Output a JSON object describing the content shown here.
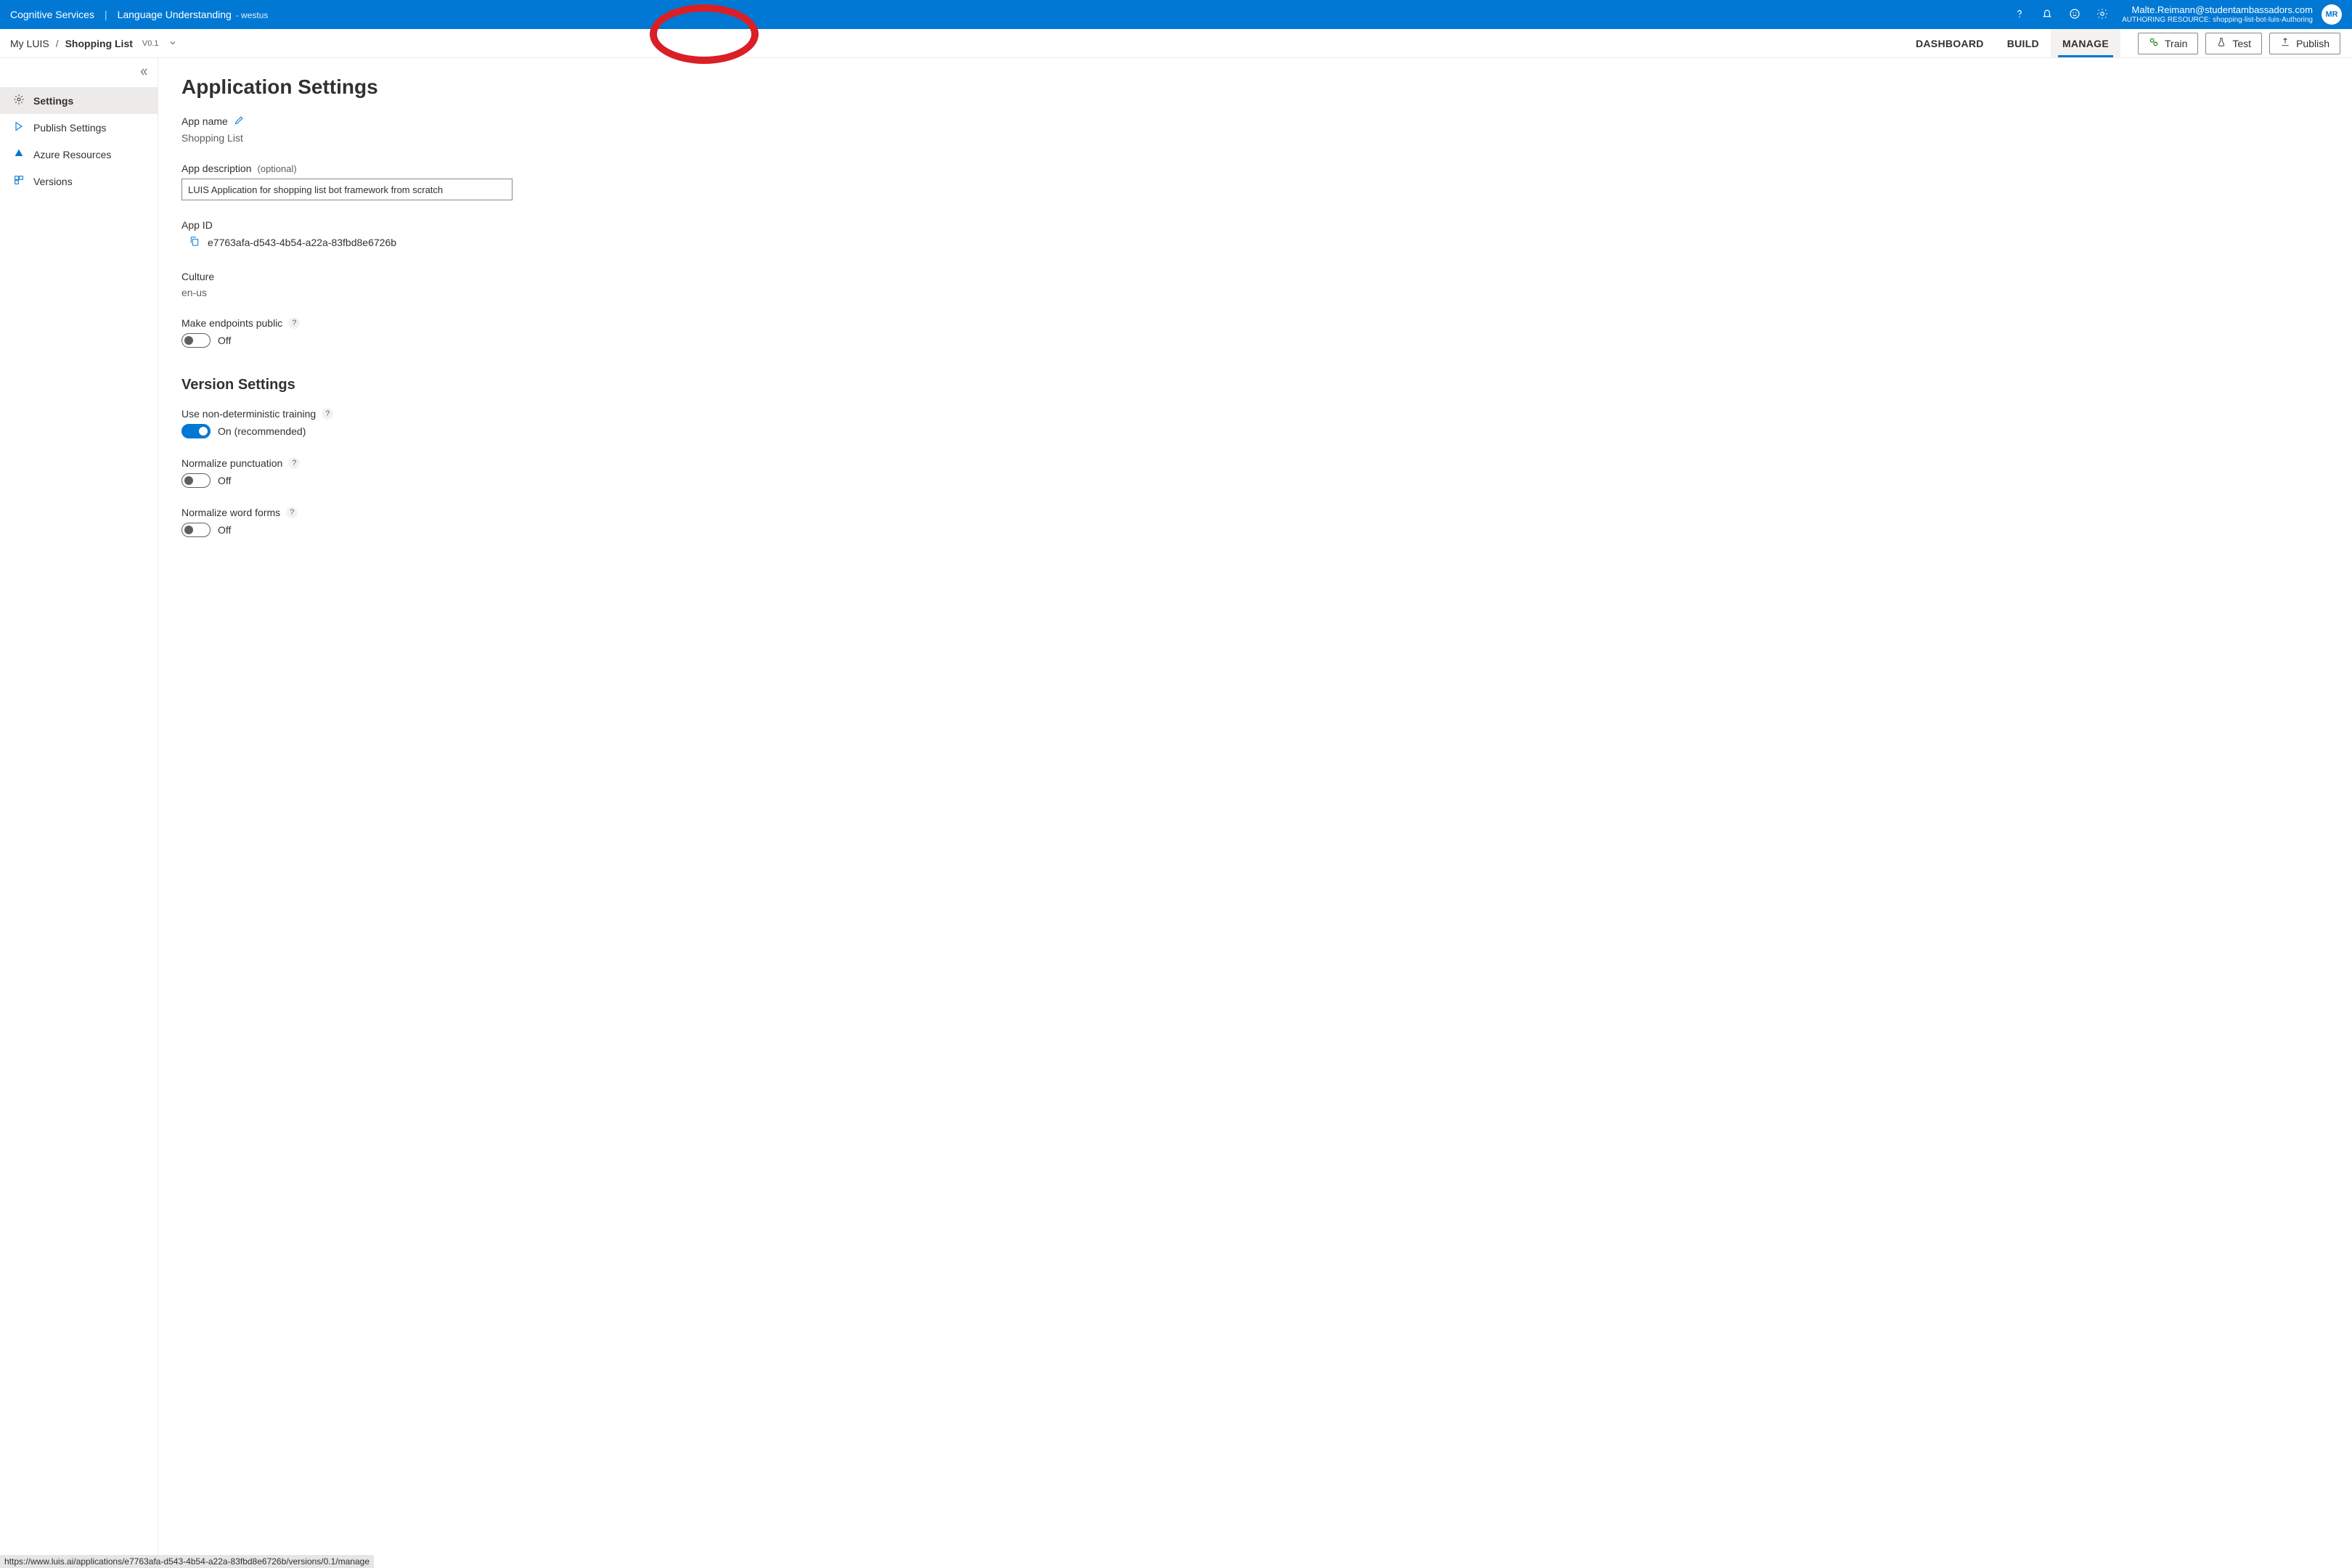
{
  "header": {
    "cognitive_services": "Cognitive Services",
    "product": "Language Understanding",
    "region": "- westus",
    "user_email": "Malte.Reimann@studentambassadors.com",
    "authoring_resource_label": "AUTHORING RESOURCE:",
    "authoring_resource_value": "shopping-list-bot-luis-Authoring",
    "avatar_initials": "MR"
  },
  "breadcrumb": {
    "root": "My LUIS",
    "app": "Shopping List",
    "version": "V0.1"
  },
  "nav": {
    "dashboard": "DASHBOARD",
    "build": "BUILD",
    "manage": "MANAGE"
  },
  "actions": {
    "train": "Train",
    "test": "Test",
    "publish": "Publish"
  },
  "sidebar": {
    "settings": "Settings",
    "publish_settings": "Publish Settings",
    "azure_resources": "Azure Resources",
    "versions": "Versions"
  },
  "content": {
    "app_settings_title": "Application Settings",
    "app_name_label": "App name",
    "app_name_value": "Shopping List",
    "app_description_label": "App description",
    "optional": "(optional)",
    "app_description_value": "LUIS Application for shopping list bot framework from scratch",
    "app_id_label": "App ID",
    "app_id_value": "e7763afa-d543-4b54-a22a-83fbd8e6726b",
    "culture_label": "Culture",
    "culture_value": "en-us",
    "endpoints_public_label": "Make endpoints public",
    "endpoints_public_state": "Off",
    "version_settings_title": "Version Settings",
    "nondeterministic_label": "Use non-deterministic training",
    "nondeterministic_state": "On (recommended)",
    "normalize_punct_label": "Normalize punctuation",
    "normalize_punct_state": "Off",
    "normalize_word_label": "Normalize word forms",
    "normalize_word_state": "Off"
  },
  "status_url": "https://www.luis.ai/applications/e7763afa-d543-4b54-a22a-83fbd8e6726b/versions/0.1/manage",
  "annotation": {
    "red_circle_style": "top:6px; left:895px; width:150px; height:82px;"
  }
}
